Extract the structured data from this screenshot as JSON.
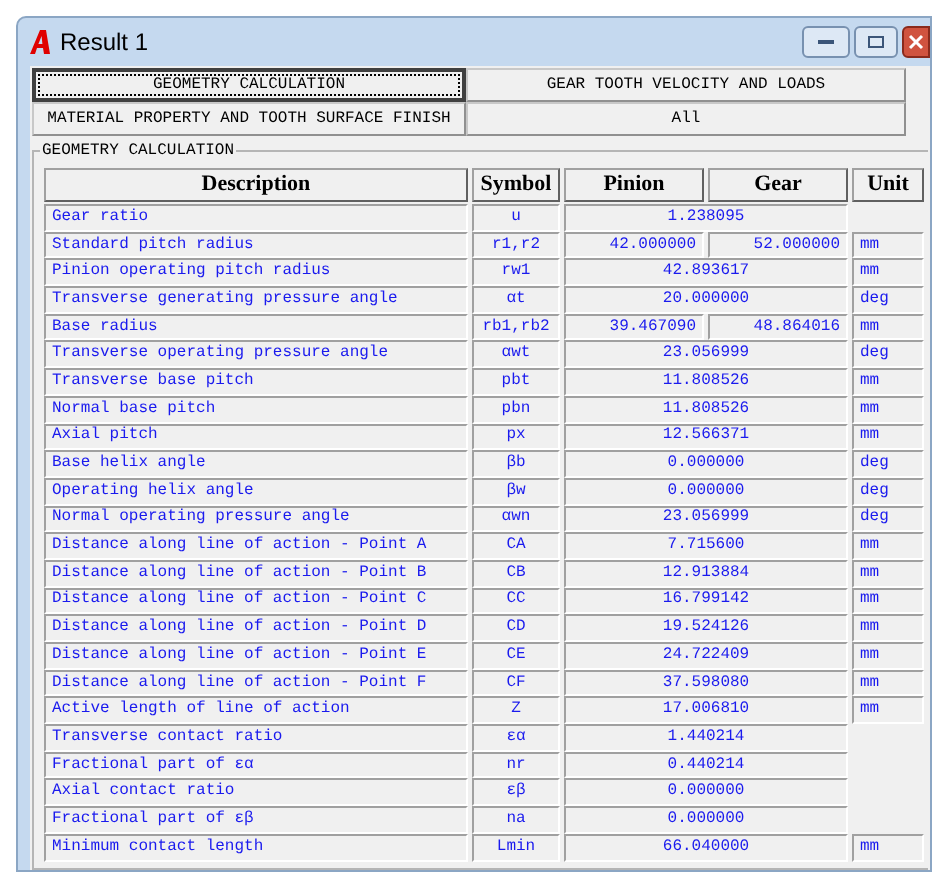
{
  "window": {
    "title": "Result 1"
  },
  "tabs": [
    {
      "label": "GEOMETRY CALCULATION",
      "selected": true
    },
    {
      "label": "GEAR TOOTH VELOCITY AND LOADS",
      "selected": false
    },
    {
      "label": "MATERIAL PROPERTY AND TOOTH SURFACE FINISH",
      "selected": false
    },
    {
      "label": "All",
      "selected": false
    }
  ],
  "group": {
    "title": "GEOMETRY CALCULATION"
  },
  "table": {
    "columns": [
      "Description",
      "Symbol",
      "Pinion",
      "Gear",
      "Unit"
    ],
    "rows": [
      {
        "description": "Gear ratio",
        "symbol": "u",
        "values": [
          "1.238095"
        ]
      },
      {
        "description": "Standard pitch radius",
        "symbol": "r1,r2",
        "values": [
          "42.000000",
          "52.000000"
        ],
        "unit": "mm"
      },
      {
        "description": "Pinion operating pitch radius",
        "symbol": "rw1",
        "values": [
          "42.893617"
        ],
        "unit": "mm"
      },
      {
        "description": "Transverse generating pressure angle",
        "symbol": "αt",
        "values": [
          "20.000000"
        ],
        "unit": "deg"
      },
      {
        "description": "Base radius",
        "symbol": "rb1,rb2",
        "values": [
          "39.467090",
          "48.864016"
        ],
        "unit": "mm"
      },
      {
        "description": "Transverse operating pressure angle",
        "symbol": "αwt",
        "values": [
          "23.056999"
        ],
        "unit": "deg"
      },
      {
        "description": "Transverse base pitch",
        "symbol": "pbt",
        "values": [
          "11.808526"
        ],
        "unit": "mm"
      },
      {
        "description": "Normal base pitch",
        "symbol": "pbn",
        "values": [
          "11.808526"
        ],
        "unit": "mm"
      },
      {
        "description": "Axial pitch",
        "symbol": "px",
        "values": [
          "12.566371"
        ],
        "unit": "mm"
      },
      {
        "description": "Base helix angle",
        "symbol": "βb",
        "values": [
          "0.000000"
        ],
        "unit": "deg"
      },
      {
        "description": "Operating helix angle",
        "symbol": "βw",
        "values": [
          "0.000000"
        ],
        "unit": "deg"
      },
      {
        "description": "Normal operating pressure angle",
        "symbol": "αwn",
        "values": [
          "23.056999"
        ],
        "unit": "deg"
      },
      {
        "description": "Distance along line of action - Point A",
        "symbol": "CA",
        "values": [
          "7.715600"
        ],
        "unit": "mm"
      },
      {
        "description": "Distance along line of action - Point B",
        "symbol": "CB",
        "values": [
          "12.913884"
        ],
        "unit": "mm"
      },
      {
        "description": "Distance along line of action - Point C",
        "symbol": "CC",
        "values": [
          "16.799142"
        ],
        "unit": "mm"
      },
      {
        "description": "Distance along line of action - Point D",
        "symbol": "CD",
        "values": [
          "19.524126"
        ],
        "unit": "mm"
      },
      {
        "description": "Distance along line of action - Point E",
        "symbol": "CE",
        "values": [
          "24.722409"
        ],
        "unit": "mm"
      },
      {
        "description": "Distance along line of action - Point F",
        "symbol": "CF",
        "values": [
          "37.598080"
        ],
        "unit": "mm"
      },
      {
        "description": "Active length of line of action",
        "symbol": "Z",
        "values": [
          "17.006810"
        ],
        "unit": "mm"
      },
      {
        "description": "Transverse contact ratio",
        "symbol": "εα",
        "values": [
          "1.440214"
        ]
      },
      {
        "description": "Fractional part of εα",
        "symbol": "nr",
        "values": [
          "0.440214"
        ]
      },
      {
        "description": "Axial contact ratio",
        "symbol": "εβ",
        "values": [
          "0.000000"
        ]
      },
      {
        "description": "Fractional part of εβ",
        "symbol": "na",
        "values": [
          "0.000000"
        ]
      },
      {
        "description": "Minimum contact length",
        "symbol": "Lmin",
        "values": [
          "66.040000"
        ],
        "unit": "mm"
      }
    ]
  }
}
